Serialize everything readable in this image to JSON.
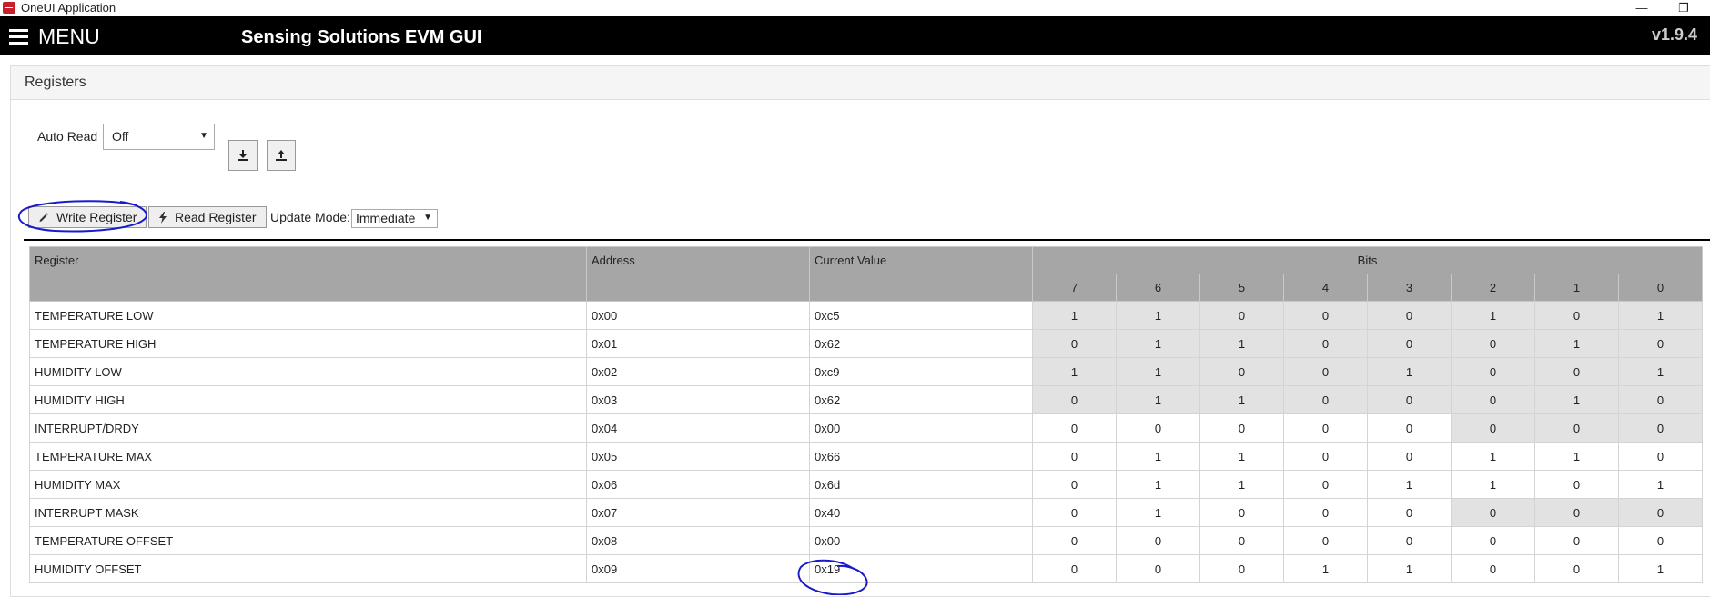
{
  "window": {
    "title": "OneUI Application",
    "minimize_glyph": "—",
    "maximize_glyph": "❐"
  },
  "appbar": {
    "menu_label": "MENU",
    "title": "Sensing Solutions EVM GUI",
    "version": "v1.9.4"
  },
  "panel": {
    "title": "Registers"
  },
  "controls": {
    "auto_read_label": "Auto Read",
    "auto_read_value": "Off",
    "write_register_label": "Write Register",
    "read_register_label": "Read Register",
    "update_mode_label": "Update Mode:",
    "update_mode_value": "Immediate",
    "load_icon": "download-icon",
    "save_icon": "upload-icon"
  },
  "table": {
    "headers": {
      "register": "Register",
      "address": "Address",
      "current_value": "Current Value",
      "bits": "Bits"
    },
    "bit_labels": [
      "7",
      "6",
      "5",
      "4",
      "3",
      "2",
      "1",
      "0"
    ],
    "rows": [
      {
        "register": "TEMPERATURE LOW",
        "address": "0x00",
        "value": "0xc5",
        "bits": [
          "1",
          "1",
          "0",
          "0",
          "0",
          "1",
          "0",
          "1"
        ],
        "readonly_bits": [
          true,
          true,
          true,
          true,
          true,
          true,
          true,
          true
        ]
      },
      {
        "register": "TEMPERATURE HIGH",
        "address": "0x01",
        "value": "0x62",
        "bits": [
          "0",
          "1",
          "1",
          "0",
          "0",
          "0",
          "1",
          "0"
        ],
        "readonly_bits": [
          true,
          true,
          true,
          true,
          true,
          true,
          true,
          true
        ]
      },
      {
        "register": "HUMIDITY LOW",
        "address": "0x02",
        "value": "0xc9",
        "bits": [
          "1",
          "1",
          "0",
          "0",
          "1",
          "0",
          "0",
          "1"
        ],
        "readonly_bits": [
          true,
          true,
          true,
          true,
          true,
          true,
          true,
          true
        ]
      },
      {
        "register": "HUMIDITY HIGH",
        "address": "0x03",
        "value": "0x62",
        "bits": [
          "0",
          "1",
          "1",
          "0",
          "0",
          "0",
          "1",
          "0"
        ],
        "readonly_bits": [
          true,
          true,
          true,
          true,
          true,
          true,
          true,
          true
        ]
      },
      {
        "register": "INTERRUPT/DRDY",
        "address": "0x04",
        "value": "0x00",
        "bits": [
          "0",
          "0",
          "0",
          "0",
          "0",
          "0",
          "0",
          "0"
        ],
        "readonly_bits": [
          false,
          false,
          false,
          false,
          false,
          true,
          true,
          true
        ]
      },
      {
        "register": "TEMPERATURE MAX",
        "address": "0x05",
        "value": "0x66",
        "bits": [
          "0",
          "1",
          "1",
          "0",
          "0",
          "1",
          "1",
          "0"
        ],
        "readonly_bits": [
          false,
          false,
          false,
          false,
          false,
          false,
          false,
          false
        ]
      },
      {
        "register": "HUMIDITY MAX",
        "address": "0x06",
        "value": "0x6d",
        "bits": [
          "0",
          "1",
          "1",
          "0",
          "1",
          "1",
          "0",
          "1"
        ],
        "readonly_bits": [
          false,
          false,
          false,
          false,
          false,
          false,
          false,
          false
        ]
      },
      {
        "register": "INTERRUPT MASK",
        "address": "0x07",
        "value": "0x40",
        "bits": [
          "0",
          "1",
          "0",
          "0",
          "0",
          "0",
          "0",
          "0"
        ],
        "readonly_bits": [
          false,
          false,
          false,
          false,
          false,
          true,
          true,
          true
        ]
      },
      {
        "register": "TEMPERATURE OFFSET",
        "address": "0x08",
        "value": "0x00",
        "bits": [
          "0",
          "0",
          "0",
          "0",
          "0",
          "0",
          "0",
          "0"
        ],
        "readonly_bits": [
          false,
          false,
          false,
          false,
          false,
          false,
          false,
          false
        ]
      },
      {
        "register": "HUMIDITY OFFSET",
        "address": "0x09",
        "value": "0x19",
        "bits": [
          "0",
          "0",
          "0",
          "1",
          "1",
          "0",
          "0",
          "1"
        ],
        "readonly_bits": [
          false,
          false,
          false,
          false,
          false,
          false,
          false,
          false
        ]
      }
    ]
  },
  "colors": {
    "header_bg": "#000000",
    "table_header_bg": "#a6a6a6",
    "readonly_bit_bg": "#e2e2e2",
    "annotation_ink": "#1a1acc"
  }
}
